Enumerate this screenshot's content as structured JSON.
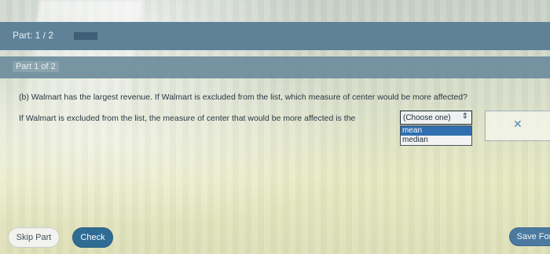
{
  "header": {
    "part_label": "Part: 1 / 2"
  },
  "subheader": {
    "part_of_label": "Part 1 of 2"
  },
  "question": {
    "text": "(b) Walmart has the largest revenue. If Walmart is excluded from the list, which measure of center would be more affected?"
  },
  "answer": {
    "prompt": "If Walmart is excluded from the list, the measure of center that would be more affected is the",
    "select": {
      "value": "(Choose one)",
      "options": [
        "mean",
        "median"
      ],
      "highlighted_option": "mean"
    }
  },
  "actions": {
    "skip_label": "Skip Part",
    "check_label": "Check",
    "save_label": "Save For"
  },
  "icons": {
    "clear": "close-icon",
    "select_toggle": "updown-icon"
  },
  "colors": {
    "header_bg": "#5f8299",
    "subheader_bg": "#6d8c9c",
    "accent": "#2f6c93",
    "highlight": "#2f6fb0"
  }
}
